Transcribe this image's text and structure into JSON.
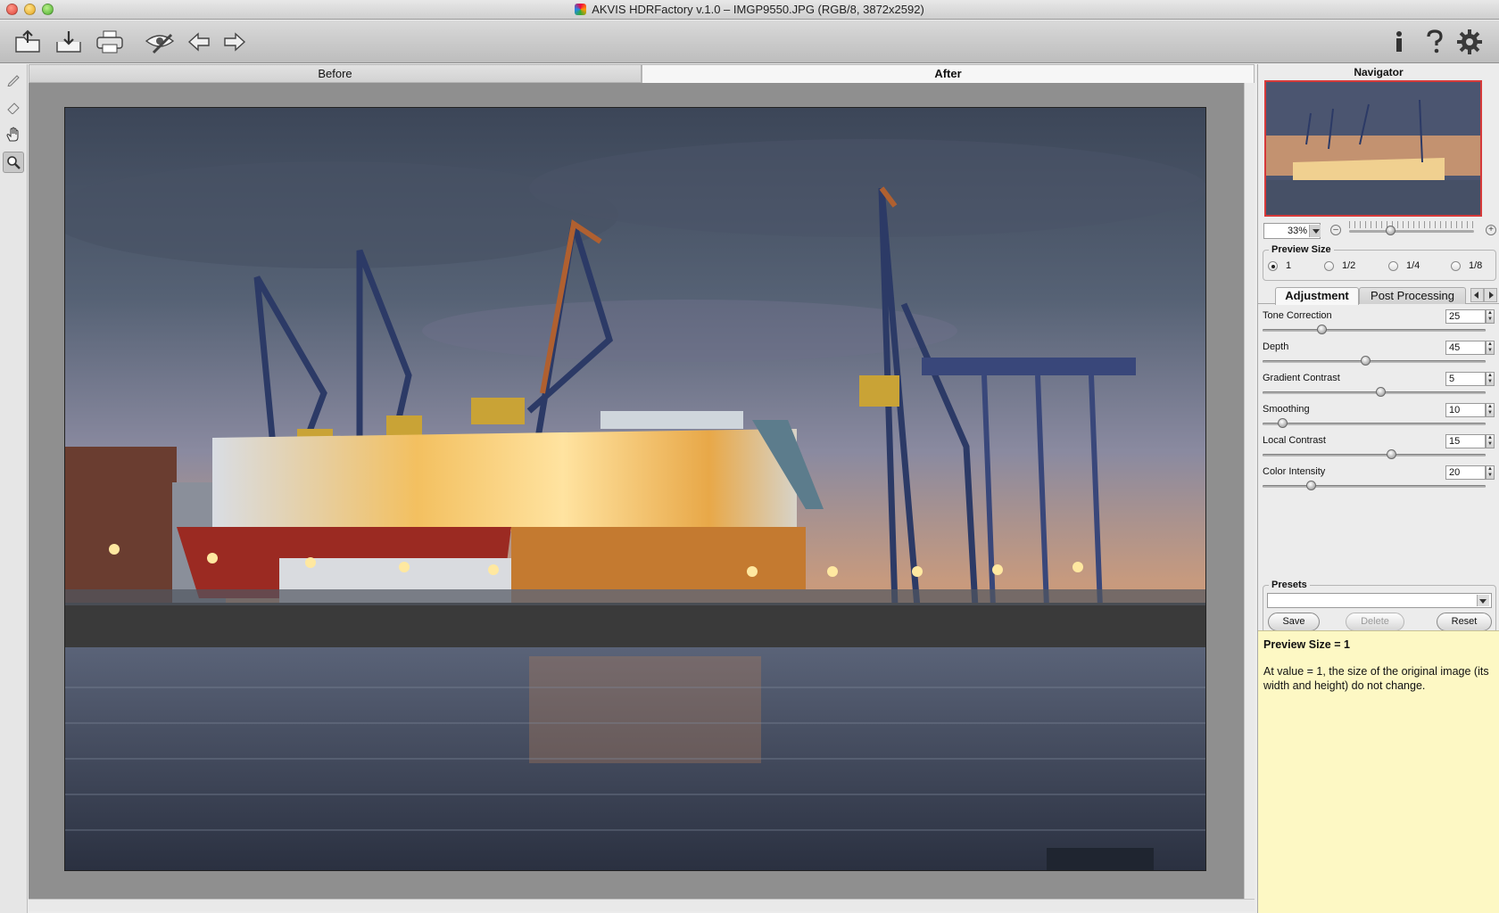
{
  "window": {
    "title": "AKVIS HDRFactory v.1.0 – IMGP9550.JPG (RGB/8, 3872x2592)"
  },
  "toolbar": {
    "left_icons": [
      "open-icon",
      "save-icon",
      "print-icon",
      "preview-eye-icon",
      "undo-arrow-icon",
      "redo-arrow-icon"
    ],
    "right_icons": [
      "info-icon",
      "help-icon",
      "settings-gear-icon"
    ]
  },
  "tools": [
    "pencil-icon",
    "eraser-icon",
    "hand-icon",
    "zoom-icon"
  ],
  "view_tabs": {
    "before": "Before",
    "after": "After",
    "active": "after"
  },
  "navigator": {
    "title": "Navigator",
    "zoom": "33%"
  },
  "preview_size": {
    "label": "Preview Size",
    "options": [
      "1",
      "1/2",
      "1/4",
      "1/8"
    ],
    "selected": "1"
  },
  "panel_tabs": {
    "adjustment": "Adjustment",
    "post_processing": "Post Processing",
    "active": "adjustment"
  },
  "params": [
    {
      "label": "Tone Correction",
      "value": "25",
      "level": 0.25
    },
    {
      "label": "Depth",
      "value": "45",
      "level": 0.45
    },
    {
      "label": "Gradient Contrast",
      "value": "5",
      "level": 0.52
    },
    {
      "label": "Smoothing",
      "value": "10",
      "level": 0.07
    },
    {
      "label": "Local Contrast",
      "value": "15",
      "level": 0.57
    },
    {
      "label": "Color Intensity",
      "value": "20",
      "level": 0.2
    }
  ],
  "presets": {
    "label": "Presets",
    "selected": "",
    "save": "Save",
    "delete": "Delete",
    "reset": "Reset"
  },
  "hint": {
    "title": "Preview Size = 1",
    "body": "At value = 1, the size of the original image (its width and height) do not change."
  },
  "colors": {
    "accent_frame": "#d63a3a",
    "hint_bg": "#fdf8c4"
  }
}
